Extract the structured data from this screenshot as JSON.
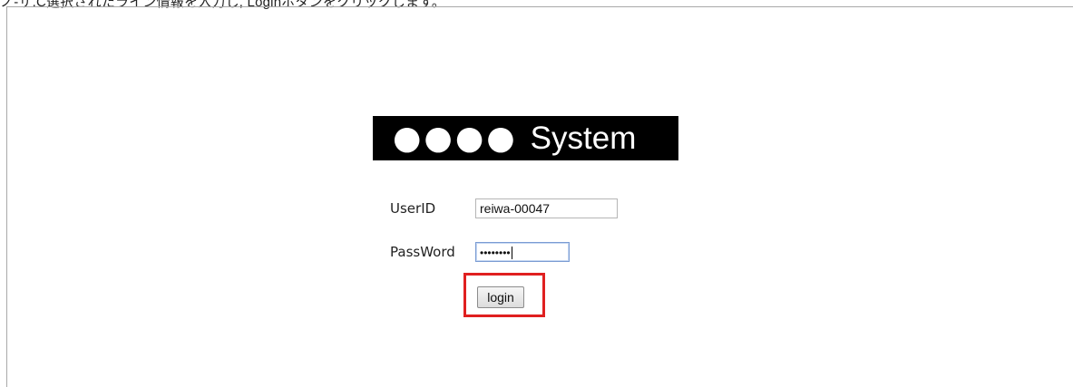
{
  "caption": "ノ-ザ.C選択されたライン情報を入力し, Loginボタンをクリックします。",
  "logo": {
    "dots": "●●●●",
    "text": "System"
  },
  "form": {
    "userid_label": "UserID",
    "userid_value": "reiwa-00047",
    "password_label": "PassWord",
    "password_masked": "••••••••",
    "login_label": "login"
  },
  "colors": {
    "highlight": "#e02020",
    "logo_bg": "#000000",
    "logo_fg": "#ffffff"
  }
}
